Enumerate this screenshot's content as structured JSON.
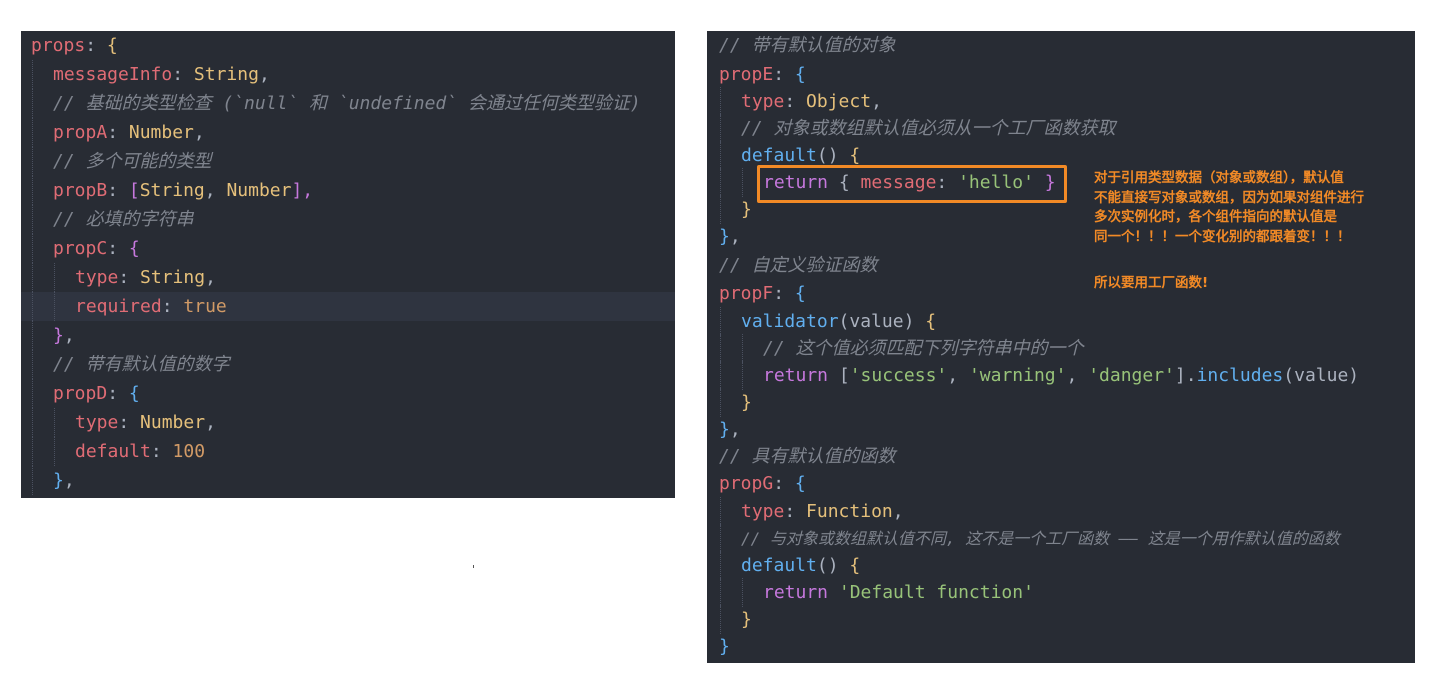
{
  "left_code": [
    {
      "k": "props",
      "c1": ": ",
      "b": "{"
    },
    {
      "k": "messageInfo",
      "c1": ": ",
      "t": "String",
      "c2": ","
    },
    {
      "c": "// 基础的类型检查 (`null` 和 `undefined` 会通过任何类型验证)"
    },
    {
      "k": "propA",
      "c1": ": ",
      "t": "Number",
      "c2": ","
    },
    {
      "c": "// 多个可能的类型"
    },
    {
      "k": "propB",
      "c1": ": ",
      "o": "[",
      "t": "String",
      "c2": ", ",
      "t2": "Number",
      "o2": "],"
    },
    {
      "c": "// 必填的字符串"
    },
    {
      "k": "propC",
      "c1": ": ",
      "b": "{"
    },
    {
      "k": "type",
      "c1": ": ",
      "t": "String",
      "c2": ","
    },
    {
      "k": "required",
      "c1": ": ",
      "n": "true"
    },
    {
      "b": "}",
      "c2": ","
    },
    {
      "c": "// 带有默认值的数字"
    },
    {
      "k": "propD",
      "c1": ": ",
      "b": "{"
    },
    {
      "k": "type",
      "c1": ": ",
      "t": "Number",
      "c2": ","
    },
    {
      "k": "default",
      "c1": ": ",
      "n": "100"
    },
    {
      "b": "}",
      "c2": ","
    }
  ],
  "right_code": [
    {
      "c": "// 带有默认值的对象"
    },
    {
      "k": "propE",
      "c1": ": ",
      "b": "{"
    },
    {
      "k": "type",
      "c1": ": ",
      "t": "Object",
      "c2": ","
    },
    {
      "c": "// 对象或数组默认值必须从一个工厂函数获取"
    },
    {
      "f": "default",
      "o": "()",
      "c1": " ",
      "b": "{"
    },
    {
      "kw": "return",
      "o": " { ",
      "k": "message",
      "c1": ": ",
      "s": "'hello'",
      "o2": " }"
    },
    {
      "b": "}"
    },
    {
      "b": "}",
      "c2": ","
    },
    {
      "c": "// 自定义验证函数"
    },
    {
      "k": "propF",
      "c1": ": ",
      "b": "{"
    },
    {
      "f": "validator",
      "o": "(value)",
      "c1": " ",
      "b": "{"
    },
    {
      "c": "// 这个值必须匹配下列字符串中的一个"
    },
    {
      "kw": "return",
      "o": " [",
      "s": "'success'",
      "c1": ", ",
      "s2": "'warning'",
      "c2": ", ",
      "s3": "'danger'",
      "o2": "].",
      "f": "includes",
      "o3": "(value)"
    },
    {
      "b": "}"
    },
    {
      "b": "}",
      "c2": ","
    },
    {
      "c": "// 具有默认值的函数"
    },
    {
      "k": "propG",
      "c1": ": ",
      "b": "{"
    },
    {
      "k": "type",
      "c1": ": ",
      "t": "Function",
      "c2": ","
    },
    {
      "c": "// 与对象或数组默认值不同, 这不是一个工厂函数 —— 这是一个用作默认值的函数"
    },
    {
      "f": "default",
      "o": "()",
      "c1": " ",
      "b": "{"
    },
    {
      "kw": "return",
      "o": " ",
      "s": "'Default function'"
    },
    {
      "b": "}"
    },
    {
      "b": "}"
    }
  ],
  "annotation": {
    "main": "对于引用类型数据（对象或数组），默认值\n不能直接写对象或数组，因为如果对组件进行\n多次实例化时，各个组件指向的默认值是\n同一个！！！一个变化别的都跟着变！！！",
    "tail": "所以要用工厂函数!"
  },
  "colors": {
    "editor_bg": "#282c34",
    "highlight": "#f28a26"
  }
}
